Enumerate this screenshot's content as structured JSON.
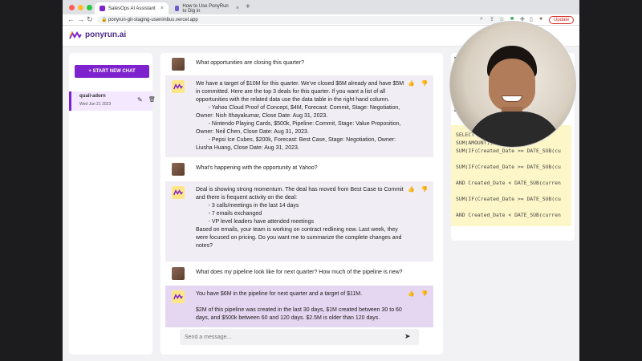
{
  "browser": {
    "tabs": [
      {
        "title": "SalesOps AI Assistant",
        "active": true
      },
      {
        "title": "How to Use PonyRun to Dig in",
        "active": false
      }
    ],
    "url": "ponyrun-git-staging-usenimbus.vercel.app",
    "update_label": "Update"
  },
  "app": {
    "logo_text": "ponyrun.ai",
    "new_chat_label": "+ START NEW CHAT",
    "conversations": [
      {
        "title": "quail-adorn",
        "date": "Wed Jun 21 2023"
      }
    ],
    "composer_placeholder": "Send a message..."
  },
  "messages": [
    {
      "role": "user",
      "text": "What opportunities are closing this quarter?"
    },
    {
      "role": "ai",
      "text": "We have a target of $10M for this quarter. We've closed $6M already and have $5M in committed. Here are the top 3 deals for this quarter. If you want a list of all opportunities with the related data use the data table in the right hand column.\n        - Yahoo Cloud Proof of Concept, $4M, Forecast: Commit, Stage: Negotiation, Owner: Nish Ithayakumar, Close Date: Aug 31, 2023.\n        - Nintendo Playing Cards, $500k, Pipeline: Commit, Stage: Value Proposition, Owner: Neil Chen, Close Date: Aug 31, 2023.\n        - Pepsi Ice Cubes, $200k, Forecast: Best Case, Stage: Negotiation, Owner: Liusha Huang, Close Date: Aug 31, 2023."
    },
    {
      "role": "user",
      "text": "What's happening with the opportunity at Yahoo?"
    },
    {
      "role": "ai",
      "text": "Deal is showing strong momentum. The deal has moved from Best Case to Commit and there is frequent activity on the deal:\n        - 3 calls/meetings in the last 14 days\n        - 7 emails exchanged\n        - VP level leaders have attended meetings\nBased on emails, your team is working on contract redlining now. Last week, they were focused on pricing. Do you want me to summarize the complete changes and notes?"
    },
    {
      "role": "user",
      "text": "What does my pipeline look like for next quarter? How much of the pipeline is new?"
    },
    {
      "role": "ai",
      "text": "You have $6M in the pipeline for next quarter and a target of $11M.\n\n$2M of this pipeline was created in the last 30 days, $1M created between 30 to 60 days, and $500k between 60 and 120 days. $2.5M is older than 120 days."
    }
  ],
  "right_panel": {
    "heading_1": "M",
    "heading_2": "D",
    "sql_lines": [
      "SELECT",
      "SUM(AMOUNT),",
      "SUM(IF(Created_Date >= DATE_SUB(cu",
      "",
      "SUM(IF(Created_Date >= DATE_SUB(cu",
      "",
      "AND Created_Date < DATE_SUB(curren",
      "",
      "SUM(IF(Created_Date >= DATE_SUB(cu",
      "",
      "AND Created_Date < DATE_SUB(curren"
    ]
  },
  "colors": {
    "accent": "#7e22ce",
    "ai_bubble": "#f1edf4",
    "ai_bubble_highlight": "#e5d6f1",
    "sql_bg": "#fdf6c8"
  }
}
